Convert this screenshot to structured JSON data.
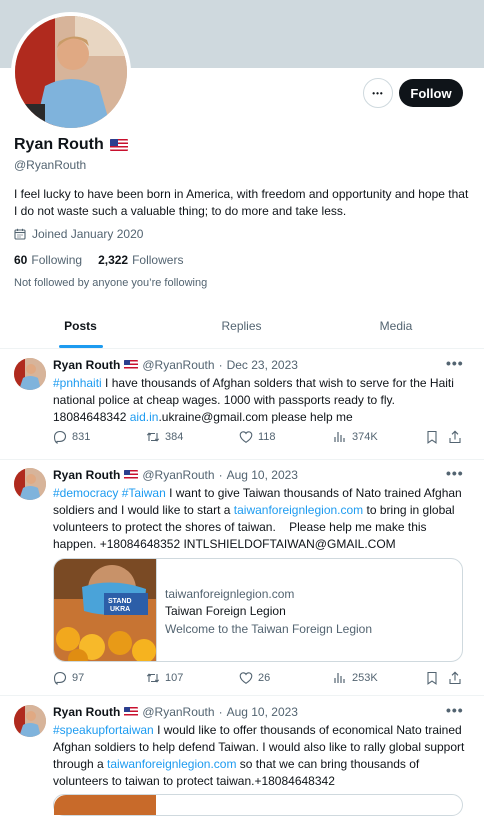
{
  "profile": {
    "name": "Ryan Routh",
    "handle": "@RyanRouth",
    "bio": "I feel lucky to have been born in America, with freedom and opportunity and hope that I do not waste such a valuable thing; to do more and take less.",
    "joined": "Joined January 2020",
    "following_count": "60",
    "following_label": "Following",
    "followers_count": "2,322",
    "followers_label": "Followers",
    "not_followed": "Not followed by anyone you’re following",
    "follow_label": "Follow",
    "more_label": "•••"
  },
  "tabs": [
    {
      "label": "Posts",
      "active": true
    },
    {
      "label": "Replies",
      "active": false
    },
    {
      "label": "Media",
      "active": false
    }
  ],
  "tweets": [
    {
      "name": "Ryan Routh",
      "handle": "@RyanRouth",
      "dot": "·",
      "date": "Dec 23, 2023",
      "menu": "•••",
      "hashtag": "#pnhhaiti",
      "text1": " I have thousands of Afghan solders that wish to serve for the Haiti national police at cheap wages. 1000 with passports ready to fly. 18084648342 ",
      "link": "aid.in",
      "text2": ".ukraine@gmail.com please help me",
      "replies": "831",
      "reposts": "384",
      "likes": "118",
      "views": "374K"
    },
    {
      "name": "Ryan Routh",
      "handle": "@RyanRouth",
      "dot": "·",
      "date": "Aug 10, 2023",
      "menu": "•••",
      "hashtag": "#democracy",
      "hashtag2": "#Taiwan",
      "text1": " I want to give Taiwan thousands of Nato trained Afghan soldiers and I would like to start a ",
      "link": "taiwanforeignlegion.com",
      "text2": " to bring in global volunteers to protect the shores of taiwan.    Please help me make this happen. +18084648352 INTLSHIELDOFTAIWAN@GMAIL.COM",
      "card": {
        "domain": "taiwanforeignlegion.com",
        "title": "Taiwan Foreign Legion",
        "description": "Welcome to the Taiwan Foreign Legion",
        "sign_text": "STAND UKRA"
      },
      "replies": "97",
      "reposts": "107",
      "likes": "26",
      "views": "253K"
    },
    {
      "name": "Ryan Routh",
      "handle": "@RyanRouth",
      "dot": "·",
      "date": "Aug 10, 2023",
      "menu": "•••",
      "hashtag": "#speakupfortaiwan",
      "text1": " I would like to offer thousands of economical Nato trained Afghan soldiers to help defend Taiwan. I would also like to rally global support through a ",
      "link": "taiwanforeignlegion.com",
      "text2": " so that we can bring thousands of volunteers to taiwan to protect taiwan.+18084648342"
    }
  ],
  "colors": {
    "accent": "#1d9bf0",
    "text": "#0f1419",
    "secondary": "#536471",
    "banner": "#cfd9de"
  }
}
